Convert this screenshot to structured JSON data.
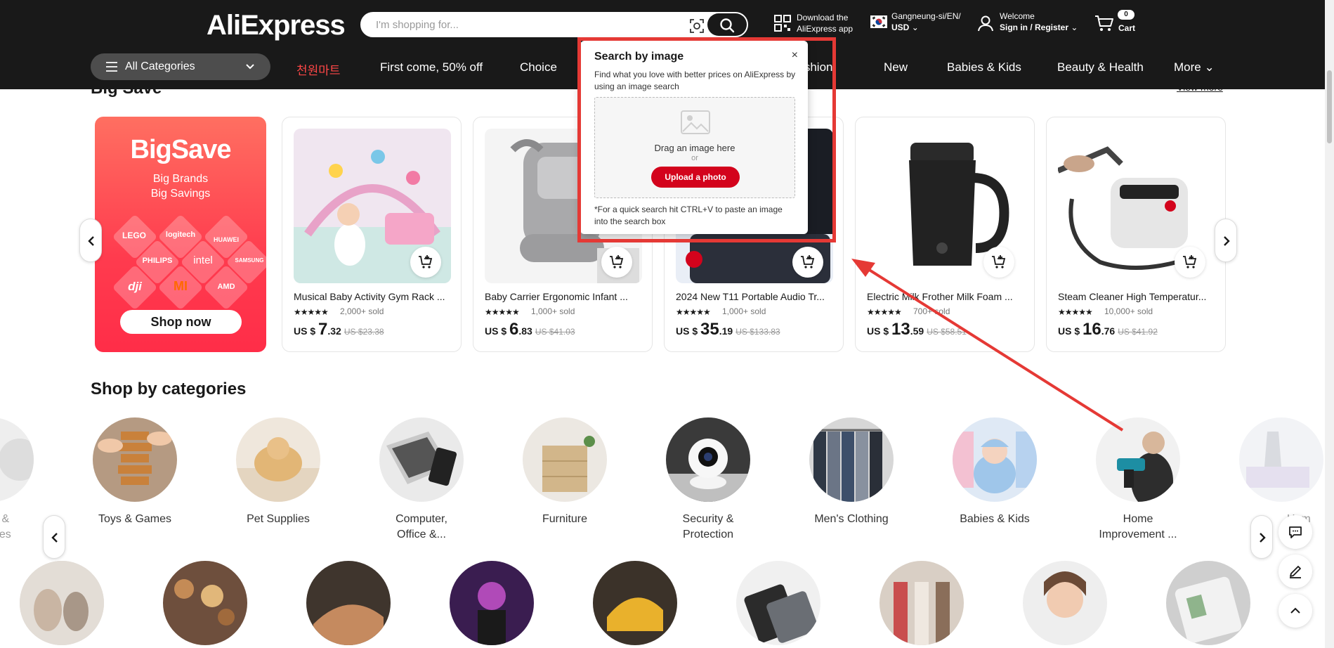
{
  "header": {
    "logo": "AliExpress",
    "search_placeholder": "I'm shopping for...",
    "download_line1": "Download the",
    "download_line2": "AliExpress app",
    "location_line1": "Gangneung-si/EN/",
    "location_line2": "USD",
    "welcome": "Welcome",
    "signin": "Sign in / Register",
    "cart_count": "0",
    "cart_label": "Cart"
  },
  "nav": {
    "all_categories": "All Categories",
    "links": [
      "천원마트",
      "First come, 50% off",
      "Choice",
      "Fashion",
      "New",
      "Babies & Kids",
      "Beauty & Health",
      "More"
    ]
  },
  "bigsave": {
    "title": "Big Save",
    "view_more": "View more",
    "promo": {
      "title": "BigSave",
      "sub1": "Big Brands",
      "sub2": "Big Savings",
      "brands": [
        "LEGO",
        "logitech",
        "HUAWEI",
        "PHILIPS",
        "intel",
        "SAMSUNG",
        "dji",
        "MI",
        "AMD"
      ],
      "button": "Shop now"
    },
    "products": [
      {
        "name": "Musical Baby Activity Gym Rack ...",
        "sold": "2,000+ sold",
        "currency": "US $",
        "price_int": "7",
        "price_dec": ".32",
        "orig": "US $23.38"
      },
      {
        "name": "Baby Carrier Ergonomic Infant ...",
        "sold": "1,000+ sold",
        "currency": "US $",
        "price_int": "6",
        "price_dec": ".83",
        "orig": "US $41.03"
      },
      {
        "name": "2024 New T11 Portable Audio Tr...",
        "sold": "1,000+ sold",
        "currency": "US $",
        "price_int": "35",
        "price_dec": ".19",
        "orig": "US $133.83"
      },
      {
        "name": "Electric Milk Frother Milk Foam ...",
        "sold": "700+ sold",
        "currency": "US $",
        "price_int": "13",
        "price_dec": ".59",
        "orig": "US $58.51"
      },
      {
        "name": "Steam Cleaner High Temperatur...",
        "sold": "10,000+ sold",
        "currency": "US $",
        "price_int": "16",
        "price_dec": ".76",
        "orig": "US $41.92"
      }
    ]
  },
  "categories": {
    "title": "Shop by categories",
    "row1": [
      {
        "line1": "Toys & Games",
        "line2": ""
      },
      {
        "line1": "Pet Supplies",
        "line2": ""
      },
      {
        "line1": "Computer,",
        "line2": "Office &..."
      },
      {
        "line1": "Furniture",
        "line2": ""
      },
      {
        "line1": "Security &",
        "line2": "Protection"
      },
      {
        "line1": "Men's Clothing",
        "line2": ""
      },
      {
        "line1": "Babies & Kids",
        "line2": ""
      },
      {
        "line1": "Home",
        "line2": "Improvement ..."
      }
    ],
    "partial_left": {
      "line1": "y &",
      "line2": "nes"
    },
    "partial_right": {
      "line1": "Hom",
      "line2": "Appli"
    }
  },
  "popup": {
    "title": "Search by image",
    "close": "×",
    "desc": "Find what you love with better prices on AliExpress by using an image search",
    "drag": "Drag an image here",
    "or": "or",
    "upload": "Upload a photo",
    "hint": "*For a quick search hit CTRL+V to paste an image into the search box"
  },
  "colors": {
    "header_bg": "#191919",
    "accent_red": "#d3031c",
    "highlight_box": "#e53935"
  }
}
